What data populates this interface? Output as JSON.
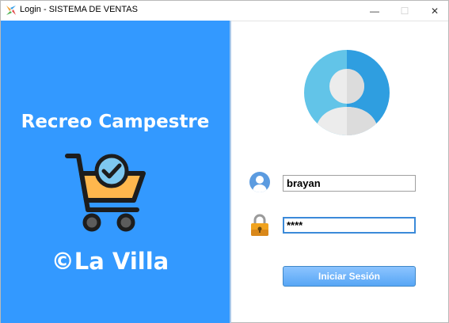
{
  "window": {
    "title": "Login - SISTEMA DE VENTAS",
    "minimize_glyph": "—",
    "maximize_glyph": "☐",
    "close_glyph": "✕"
  },
  "brand": {
    "title": "Recreo Campestre",
    "subtitle": "©La Villa",
    "icon": "shopping-cart-check-icon"
  },
  "login": {
    "avatar_icon": "user-avatar-icon",
    "username_icon": "user-icon",
    "password_icon": "padlock-icon",
    "username_value": "brayan",
    "password_value": "****",
    "submit_label": "Iniciar Sesión"
  },
  "colors": {
    "left_panel": "#3399ff",
    "button": "#57a6f5",
    "cart_basket": "#ffb74d",
    "check_circle": "#7ec8f0"
  }
}
